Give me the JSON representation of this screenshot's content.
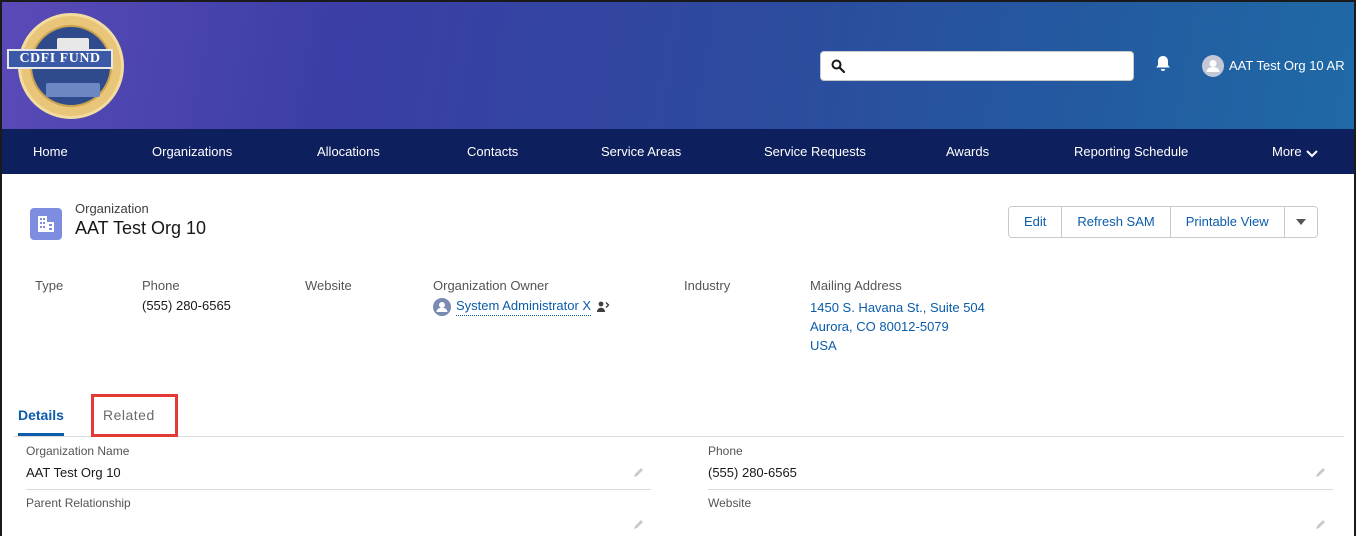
{
  "app": {
    "logo_text": "CDFI FUND",
    "user_name": "AAT Test Org 10 AR"
  },
  "nav": {
    "items": [
      "Home",
      "Organizations",
      "Allocations",
      "Contacts",
      "Service Areas",
      "Service Requests",
      "Awards",
      "Reporting Schedule"
    ],
    "more_label": "More"
  },
  "record": {
    "object_type": "Organization",
    "name": "AAT Test Org 10",
    "actions": [
      "Edit",
      "Refresh SAM",
      "Printable View"
    ]
  },
  "highlights": {
    "type_label": "Type",
    "phone_label": "Phone",
    "phone_value": "(555) 280-6565",
    "website_label": "Website",
    "owner_label": "Organization Owner",
    "owner_value": "System Administrator X",
    "industry_label": "Industry",
    "address_label": "Mailing Address",
    "address_line1": "1450 S. Havana St., Suite 504",
    "address_line2": "Aurora, CO 80012-5079",
    "address_line3": "USA"
  },
  "tabs": {
    "details": "Details",
    "related": "Related"
  },
  "details": {
    "org_name_label": "Organization Name",
    "org_name_value": "AAT Test Org 10",
    "parent_label": "Parent Relationship",
    "parent_value": "",
    "phone_label": "Phone",
    "phone_value": "(555) 280-6565",
    "website_label": "Website",
    "website_value": ""
  },
  "colors": {
    "nav_bg": "#0d1f5c",
    "link": "#0b5cab",
    "highlight_box": "#e53935"
  }
}
